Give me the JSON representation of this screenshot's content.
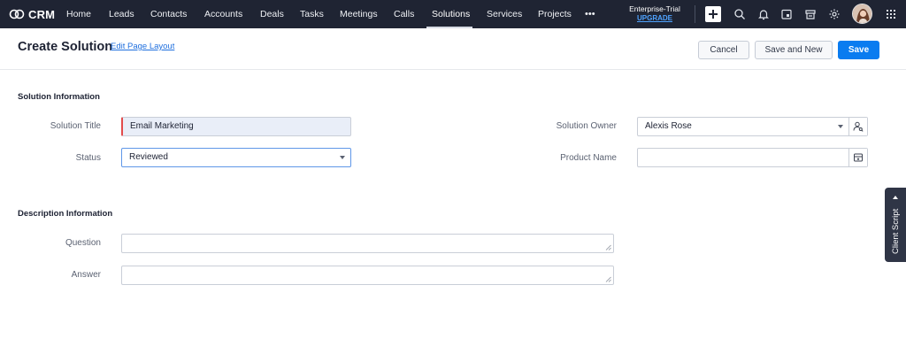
{
  "app": {
    "name": "CRM"
  },
  "nav": {
    "items": [
      {
        "label": "Home"
      },
      {
        "label": "Leads"
      },
      {
        "label": "Contacts"
      },
      {
        "label": "Accounts"
      },
      {
        "label": "Deals"
      },
      {
        "label": "Tasks"
      },
      {
        "label": "Meetings"
      },
      {
        "label": "Calls"
      },
      {
        "label": "Solutions"
      },
      {
        "label": "Services"
      },
      {
        "label": "Projects"
      }
    ],
    "active": "Solutions",
    "more": "•••"
  },
  "trial": {
    "edition": "Enterprise-Trial",
    "upgrade": "UPGRADE",
    "link_color": "#4fa3ff"
  },
  "top_icons": [
    "plus-icon",
    "search-icon",
    "bell-icon",
    "calendar-icon",
    "marketplace-icon",
    "gear-icon",
    "avatar",
    "app-grid-icon"
  ],
  "header": {
    "title": "Create Solution",
    "edit_layout": "Edit Page Layout",
    "cancel": "Cancel",
    "save_and_new": "Save and New",
    "save": "Save"
  },
  "solution_info": {
    "title": "Solution Information",
    "solution_title_label": "Solution Title",
    "solution_title_value": "Email Marketing",
    "status_label": "Status",
    "status_value": "Reviewed",
    "owner_label": "Solution Owner",
    "owner_value": "Alexis Rose",
    "product_label": "Product Name",
    "product_value": ""
  },
  "description_info": {
    "title": "Description Information",
    "question_label": "Question",
    "question_value": "",
    "answer_label": "Answer",
    "answer_value": ""
  },
  "client_script": {
    "label": "Client Script"
  },
  "colors": {
    "topbar": "#1f2433",
    "primary": "#0a7cf0",
    "mandatory_marker": "#e24b4b",
    "link": "#1f6fde"
  }
}
